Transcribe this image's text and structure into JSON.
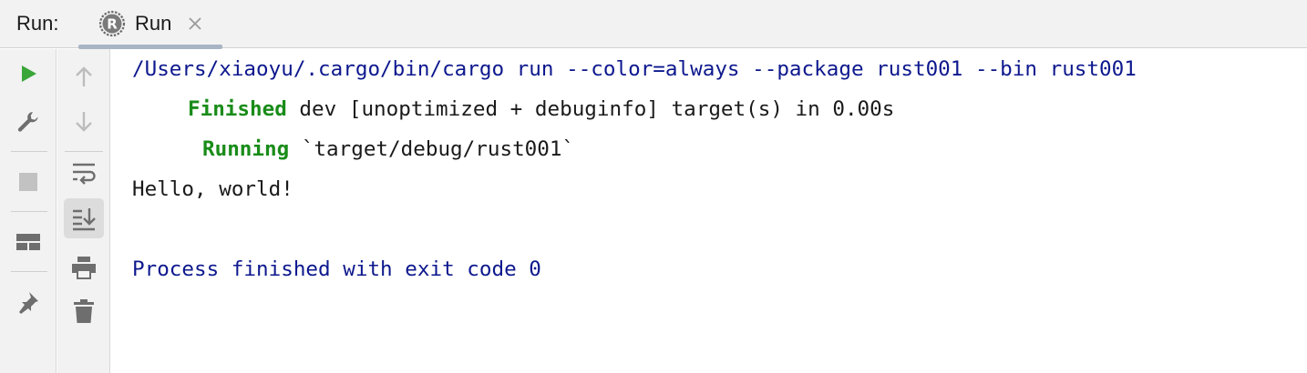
{
  "header": {
    "run_label": "Run:",
    "tab": {
      "label": "Run",
      "icon": "rust-logo-icon"
    }
  },
  "toolbar_left": [
    {
      "name": "rerun",
      "icon": "play-icon"
    },
    {
      "name": "settings",
      "icon": "wrench-icon"
    },
    {
      "name": "stop",
      "icon": "stop-icon"
    },
    {
      "name": "layout",
      "icon": "layout-icon"
    },
    {
      "name": "pin",
      "icon": "pin-icon"
    }
  ],
  "toolbar_right": [
    {
      "name": "up",
      "icon": "arrow-up-icon"
    },
    {
      "name": "down",
      "icon": "arrow-down-icon"
    },
    {
      "name": "soft-wrap",
      "icon": "soft-wrap-icon"
    },
    {
      "name": "scroll-to-end",
      "icon": "scroll-to-end-icon"
    },
    {
      "name": "print",
      "icon": "print-icon"
    },
    {
      "name": "clear",
      "icon": "trash-icon"
    }
  ],
  "console": {
    "command": "/Users/xiaoyu/.cargo/bin/cargo run --color=always --package rust001 --bin rust001",
    "finished_keyword": "Finished",
    "finished_rest": " dev [unoptimized + debuginfo] target(s) in 0.00s",
    "running_keyword": "Running",
    "running_rest": " `target/debug/rust001`",
    "output": "Hello, world!",
    "exit_message": "Process finished with exit code 0"
  },
  "colors": {
    "command": "#0d188d",
    "keyword_green": "#198c19",
    "run_green": "#3aa63a",
    "icon_gray": "#6e6e6e"
  }
}
